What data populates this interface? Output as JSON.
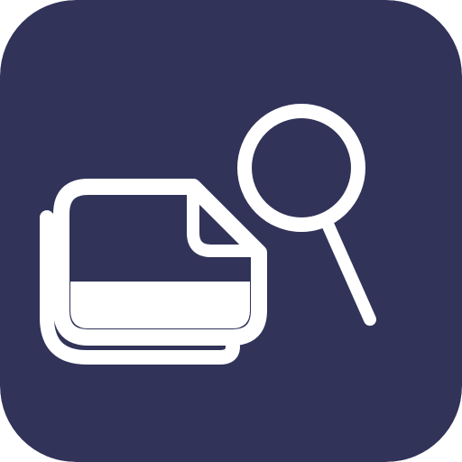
{
  "icon": {
    "name": "file-search-app-icon",
    "glyphs": [
      "stacked-files-icon",
      "magnifier-icon"
    ],
    "colors": {
      "background": "#313359",
      "foreground": "#ffffff"
    }
  }
}
